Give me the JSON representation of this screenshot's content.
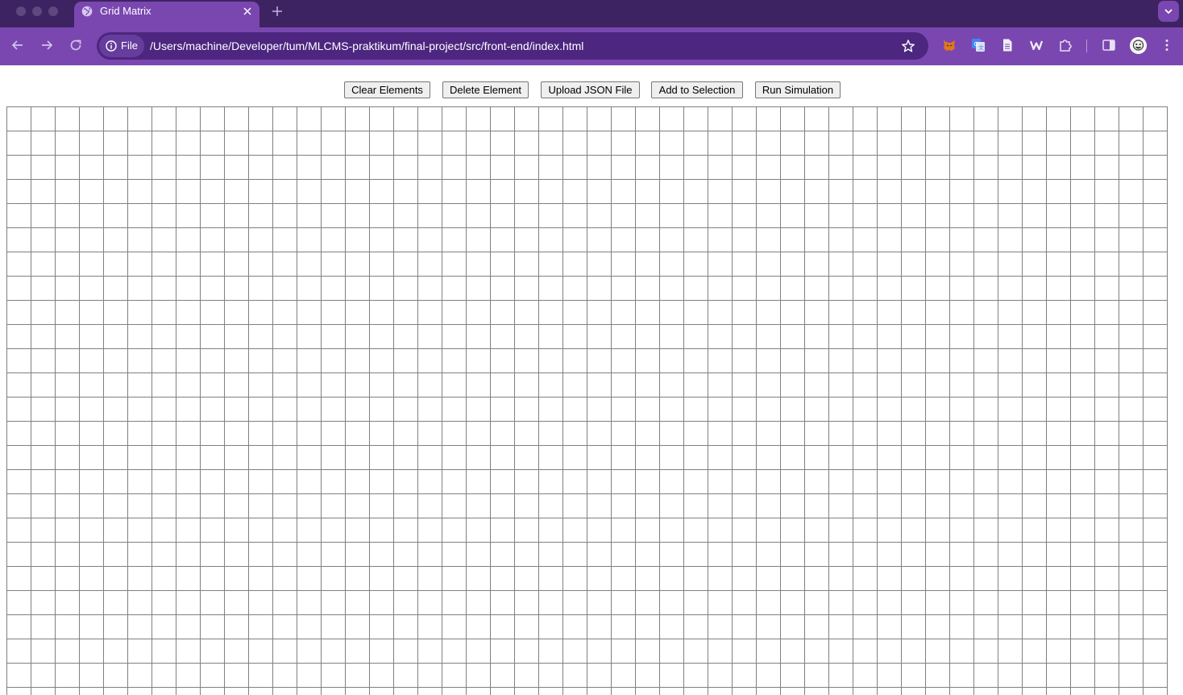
{
  "browser": {
    "tab": {
      "title": "Grid Matrix"
    },
    "omnibox": {
      "security_chip": "File",
      "url": "/Users/machine/Developer/tum/MLCMS-praktikum/final-project/src/front-end/index.html"
    },
    "colors": {
      "tabstrip": "#3e2363",
      "toolbar": "#7a47b0",
      "omnibox": "#4d2680"
    }
  },
  "page": {
    "buttons": {
      "clear": "Clear Elements",
      "delete": "Delete Element",
      "upload": "Upload JSON File",
      "add_selection": "Add to Selection",
      "run": "Run Simulation"
    },
    "grid": {
      "line_color": "#808080"
    }
  }
}
